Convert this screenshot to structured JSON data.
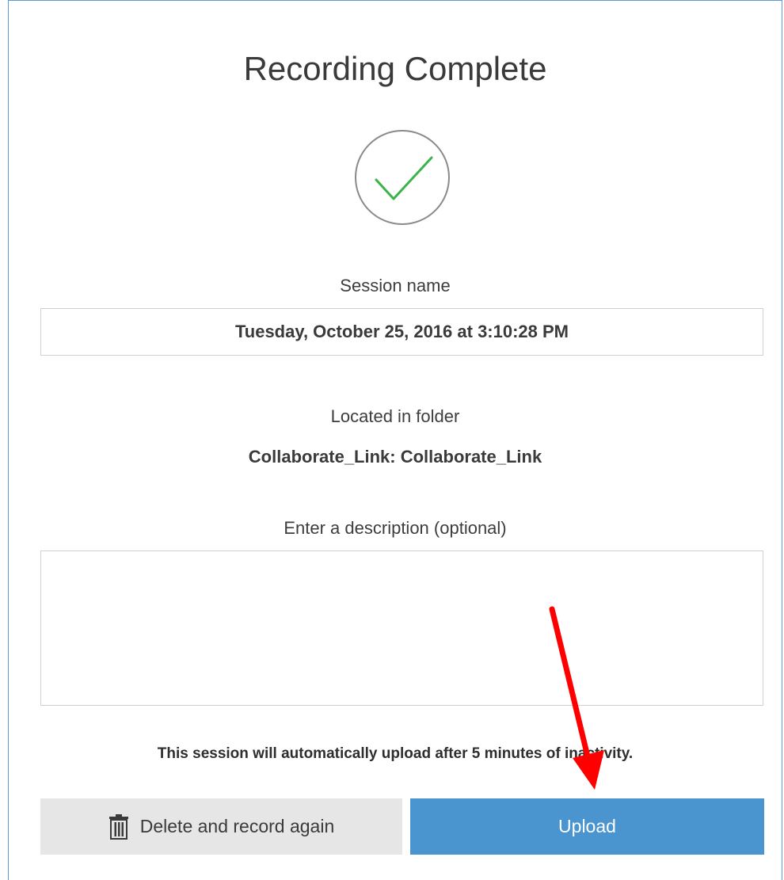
{
  "dialog": {
    "title": "Recording Complete",
    "check_icon": "checkmark-circle-icon",
    "check_color": "#3cb34a",
    "session": {
      "label": "Session name",
      "value": "Tuesday, October 25, 2016 at 3:10:28 PM"
    },
    "folder": {
      "label": "Located in folder",
      "value": "Collaborate_Link: Collaborate_Link"
    },
    "description": {
      "label": "Enter a description (optional)",
      "value": ""
    },
    "auto_upload_note": "This session will automatically upload after 5 minutes of inactivity.",
    "buttons": {
      "delete_label": "Delete and record again",
      "delete_icon": "trash-icon",
      "upload_label": "Upload",
      "upload_color": "#4a94cf"
    },
    "annotation": {
      "arrow_icon": "red-arrow-icon",
      "arrow_color": "#ff0000"
    }
  }
}
